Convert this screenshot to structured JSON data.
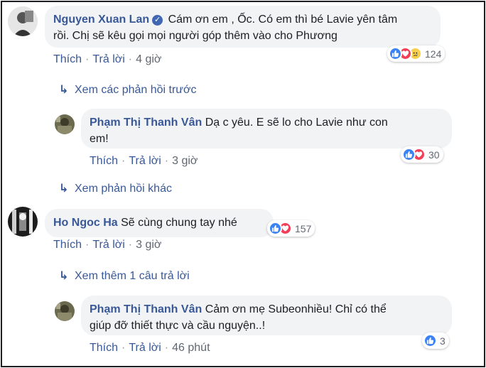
{
  "comments": [
    {
      "author": "Nguyen Xuan Lan",
      "verified": true,
      "text_line1": "Cám ơn em , Ốc. Có em thì bé Lavie yên tâm",
      "text_line2": "rồi. Chị sẽ kêu gọi mọi người góp thêm vào cho Phương",
      "like": "Thích",
      "reply": "Trả lời",
      "time": "4 giờ",
      "reactions": [
        "like-icon",
        "love-icon",
        "sad-icon"
      ],
      "reaction_count": "124"
    },
    {
      "author": "Phạm Thị Thanh Vân",
      "text_line1": "Dạ c yêu. E sẽ lo cho Lavie như con",
      "text_line2": "em!",
      "like": "Thích",
      "reply": "Trả lời",
      "time": "3 giờ",
      "reactions": [
        "like-icon",
        "love-icon"
      ],
      "reaction_count": "30"
    },
    {
      "author": "Ho Ngoc Ha",
      "text_line1": "Sẽ cùng chung tay nhé",
      "like": "Thích",
      "reply": "Trả lời",
      "time": "3 giờ",
      "reactions": [
        "like-icon",
        "love-icon"
      ],
      "reaction_count": "157"
    },
    {
      "author": "Phạm Thị Thanh Vân",
      "text_line1": "Cảm ơn mẹ Subeonhiều! Chỉ có thể",
      "text_line2": "giúp đỡ thiết thực và cầu nguyện..!",
      "like": "Thích",
      "reply": "Trả lời",
      "time": "46 phút",
      "reactions": [
        "like-icon"
      ],
      "reaction_count": "3"
    }
  ],
  "links": {
    "previous_replies": "Xem các phản hồi trước",
    "other_replies": "Xem phản hồi khác",
    "one_more_reply": "Xem thêm 1 câu trả lời"
  },
  "colors": {
    "link_blue": "#385898",
    "bubble_bg": "#f2f3f5",
    "like_blue": "#3b82f6",
    "love_red": "#f33e58",
    "sad_yellow": "#f7cf4d"
  }
}
